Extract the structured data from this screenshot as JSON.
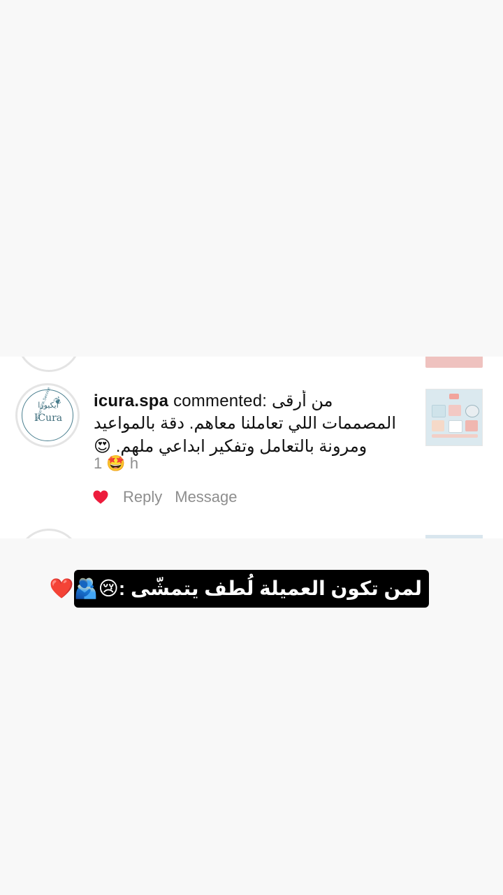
{
  "comment": {
    "username": "icura.spa",
    "action": "commented:",
    "text_line1": "من أرقى",
    "text_line2": "المصممات اللي تعاملنا معاهم. دقة بالمواعيد",
    "text_line3": "ومرونة بالتعامل وتفكير ابداعي ملهم.",
    "emoji_inline": "😍",
    "time_prefix": "1",
    "time_emoji": "🤩",
    "time_suffix": "h"
  },
  "avatar": {
    "logo_arabic": "ايكيورا",
    "logo_english": "ICura",
    "ring_text": "Home SPA Service"
  },
  "actions": {
    "reply_label": "Reply",
    "message_label": "Message"
  },
  "caption": {
    "text": "لمن تكون العميلة لُطف يتمشّى :😢🫂❤️"
  },
  "colors": {
    "background": "#f8f8f8",
    "card": "#ffffff",
    "like_heart": "#ed1c3c",
    "muted_text": "#8e8e8e",
    "caption_bg": "#000000"
  }
}
